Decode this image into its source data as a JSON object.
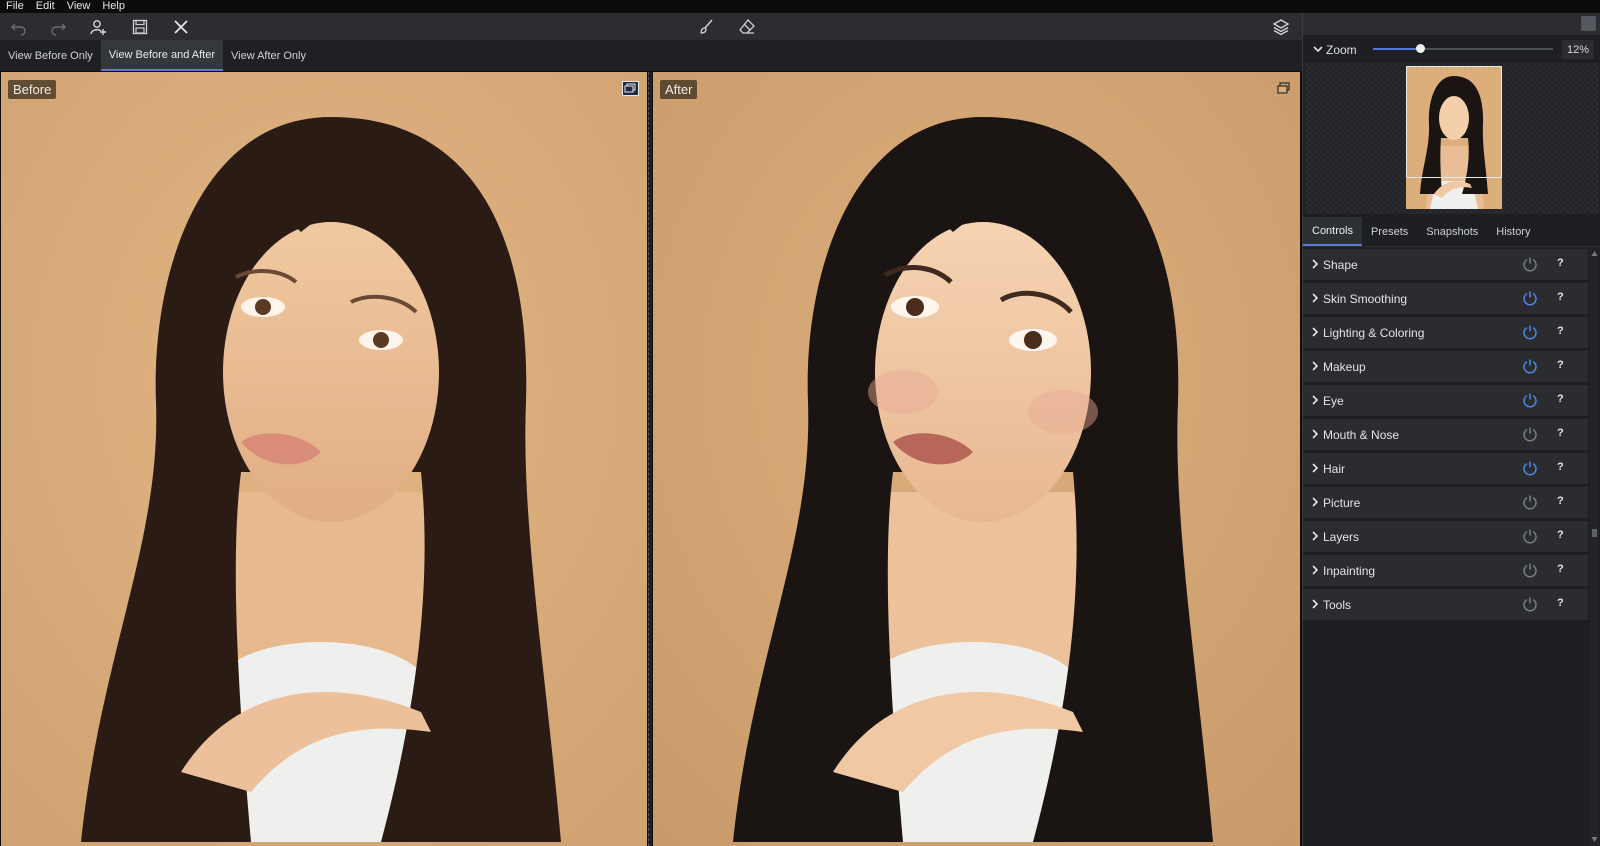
{
  "menu": {
    "items": [
      "File",
      "Edit",
      "View",
      "Help"
    ]
  },
  "toolbar": {
    "icons": [
      "undo-icon",
      "redo-icon",
      "add-person-icon",
      "save-icon",
      "close-icon",
      "brush-icon",
      "eraser-icon",
      "layers-icon"
    ]
  },
  "view_tabs": {
    "before_only": "View Before Only",
    "before_after": "View Before and After",
    "after_only": "View After Only",
    "active": "before_after"
  },
  "canvas": {
    "before_label": "Before",
    "after_label": "After"
  },
  "zoom": {
    "title": "Zoom",
    "value": "12%",
    "slider_fraction": 0.26
  },
  "panel_tabs": {
    "controls": "Controls",
    "presets": "Presets",
    "snapshots": "Snapshots",
    "history": "History",
    "active": "controls"
  },
  "controls": [
    {
      "label": "Shape",
      "enabled": false
    },
    {
      "label": "Skin Smoothing",
      "enabled": true
    },
    {
      "label": "Lighting & Coloring",
      "enabled": true
    },
    {
      "label": "Makeup",
      "enabled": true
    },
    {
      "label": "Eye",
      "enabled": true
    },
    {
      "label": "Mouth & Nose",
      "enabled": false
    },
    {
      "label": "Hair",
      "enabled": true
    },
    {
      "label": "Picture",
      "enabled": false
    },
    {
      "label": "Layers",
      "enabled": false
    },
    {
      "label": "Inpainting",
      "enabled": false
    },
    {
      "label": "Tools",
      "enabled": false
    }
  ],
  "help_glyph": "?",
  "colors": {
    "accent": "#4f78d6",
    "power_on": "#4f86e8",
    "power_off": "#7b7e84",
    "photo_bg": "#d9ad7c"
  }
}
